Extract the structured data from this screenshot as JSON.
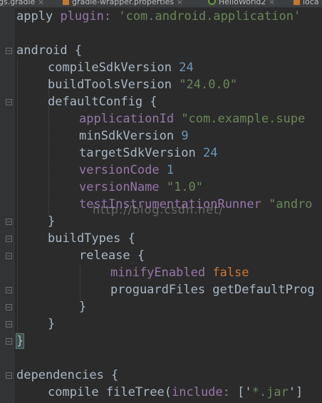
{
  "tabs": [
    {
      "label": "gs.gradle",
      "close": "×"
    },
    {
      "label": "gradle-wrapper.properties",
      "close": "×"
    },
    {
      "label": "HelloWorld2",
      "close": "×"
    },
    {
      "label": "loca",
      "close": ""
    }
  ],
  "code": {
    "l1": {
      "kw": "apply",
      "prop": "plugin:",
      "str": "'com.android.application'"
    },
    "l3": {
      "kw": "android {"
    },
    "l4": {
      "kw": "compileSdkVersion",
      "num": "24"
    },
    "l5": {
      "kw": "buildToolsVersion",
      "str": "\"24.0.0\""
    },
    "l6": {
      "kw": "defaultConfig {"
    },
    "l7": {
      "prop": "applicationId",
      "str": "\"com.example.supe"
    },
    "l8": {
      "kw": "minSdkVersion",
      "num": "9"
    },
    "l9": {
      "kw": "targetSdkVersion",
      "num": "24"
    },
    "l10": {
      "prop": "versionCode",
      "num": "1"
    },
    "l11": {
      "prop": "versionName",
      "str": "\"1.0\""
    },
    "l12": {
      "prop": "testInstrumentationRunner",
      "str": "\"andro"
    },
    "l13": {
      "kw": "}"
    },
    "l14": {
      "kw": "buildTypes {"
    },
    "l15": {
      "kw": "release {"
    },
    "l16": {
      "prop": "minifyEnabled",
      "bool": "false"
    },
    "l17": {
      "kw": "proguardFiles getDefaultProg"
    },
    "l18": {
      "kw": "}"
    },
    "l19": {
      "kw": "}"
    },
    "l20": {
      "kw": "}"
    },
    "l22": {
      "kw": "dependencies {"
    },
    "l23": {
      "kw": "compile fileTree(",
      "prop": "include:",
      "rest": "['",
      "str": "*.jar",
      "tail": "']"
    }
  },
  "watermark": "http://blog.csdn.net/",
  "colors": {
    "bg": "#2b2b2b",
    "keyword": "#a9b7c6",
    "property": "#9876aa",
    "number": "#6897bb",
    "string": "#6a8759",
    "boolean": "#cc7832"
  }
}
